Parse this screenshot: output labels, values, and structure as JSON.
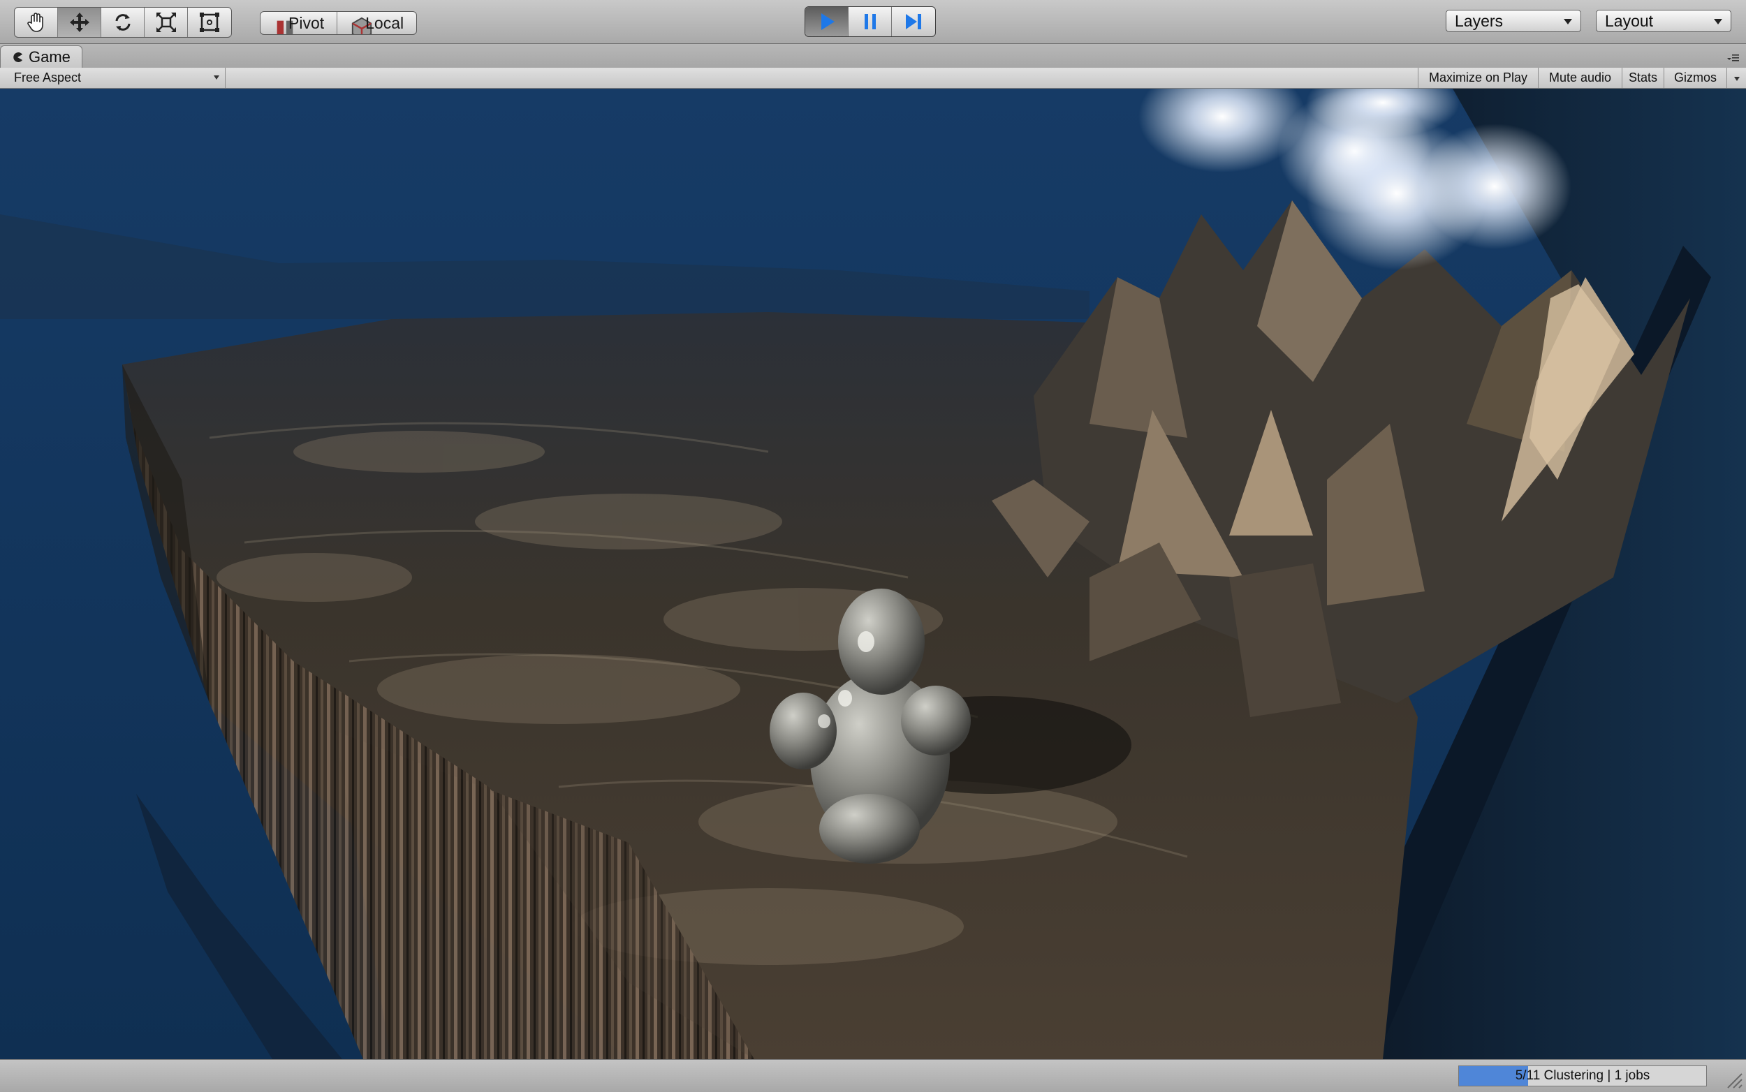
{
  "toolbar": {
    "transform_tools": [
      {
        "name": "hand-tool",
        "icon": "hand-icon",
        "active": false
      },
      {
        "name": "move-tool",
        "icon": "move-arrows-icon",
        "active": true
      },
      {
        "name": "rotate-tool",
        "icon": "rotate-icon",
        "active": false
      },
      {
        "name": "scale-tool",
        "icon": "scale-icon",
        "active": false
      },
      {
        "name": "rect-tool",
        "icon": "rect-transform-icon",
        "active": false
      }
    ],
    "pivot_label": "Pivot",
    "local_label": "Local",
    "playback": {
      "play_icon": "play-icon",
      "pause_icon": "pause-icon",
      "step_icon": "step-icon",
      "playing": true,
      "accent": "#1e78e8"
    },
    "layers_label": "Layers",
    "layout_label": "Layout"
  },
  "game_tab": {
    "label": "Game",
    "icon": "pacman-icon",
    "menu_icon": "panel-menu-icon"
  },
  "game_bar": {
    "aspect_label": "Free Aspect",
    "maximize_label": "Maximize on Play",
    "mute_label": "Mute audio",
    "stats_label": "Stats",
    "gizmos_label": "Gizmos"
  },
  "scene": {
    "sky_color": "#143a63",
    "terrain_color": "#3a342c",
    "character_color": "#8a8a84"
  },
  "status": {
    "progress_text": "5/11 Clustering | 1 jobs",
    "progress_fraction": 0.28,
    "progress_color": "#4f86d8"
  }
}
